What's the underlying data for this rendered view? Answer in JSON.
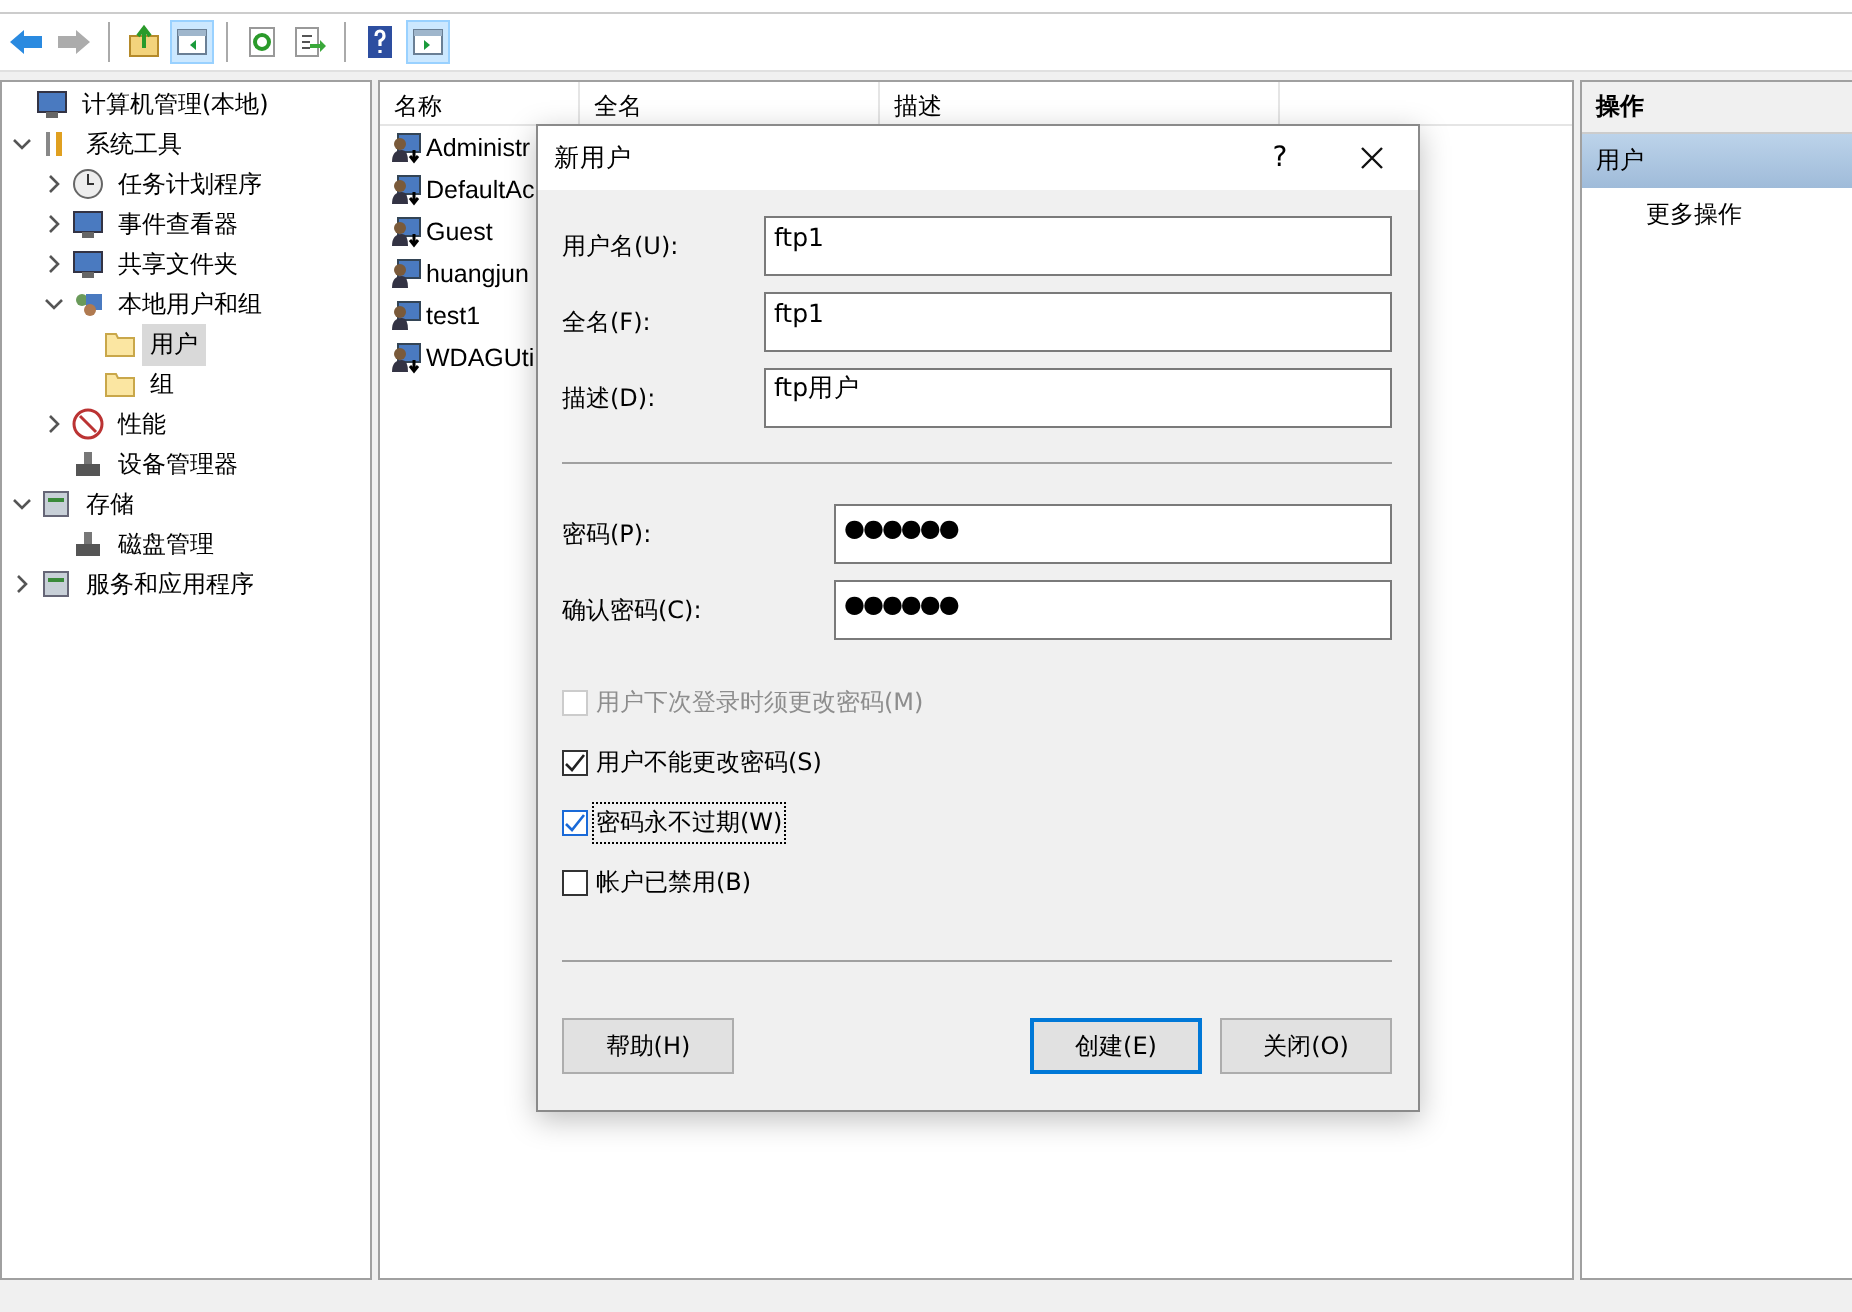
{
  "toolbar": [
    {
      "pressed": false,
      "disabled": false
    },
    {
      "pressed": false,
      "disabled": true
    },
    {
      "pressed": false,
      "disabled": false
    },
    {
      "pressed": true,
      "disabled": false
    },
    {
      "pressed": false,
      "disabled": false
    },
    {
      "pressed": false,
      "disabled": false
    },
    {
      "pressed": false,
      "disabled": false
    },
    {
      "pressed": true,
      "disabled": false
    }
  ],
  "tree": [
    {
      "label": "计算机管理(本地)",
      "selected": false,
      "children": [
        {
          "label": "系统工具",
          "expanded": true,
          "selected": false,
          "children": [
            {
              "label": "任务计划程序",
              "expanded": false,
              "selected": false
            },
            {
              "label": "事件查看器",
              "expanded": false,
              "selected": false
            },
            {
              "label": "共享文件夹",
              "expanded": false,
              "selected": false
            },
            {
              "label": "本地用户和组",
              "expanded": true,
              "selected": false,
              "children": [
                {
                  "label": "用户",
                  "selected": true
                },
                {
                  "label": "组",
                  "selected": false
                }
              ]
            },
            {
              "label": "性能",
              "expanded": false,
              "selected": false
            },
            {
              "label": "设备管理器",
              "selected": false
            }
          ]
        },
        {
          "label": "存储",
          "expanded": true,
          "selected": false,
          "children": [
            {
              "label": "磁盘管理",
              "selected": false
            }
          ]
        },
        {
          "label": "服务和应用程序",
          "expanded": false,
          "selected": false
        }
      ]
    }
  ],
  "list": {
    "columns": [
      "名称",
      "全名",
      "描述"
    ],
    "rows": [
      "Administr",
      "DefaultAc",
      "Guest",
      "huangjun",
      "test1",
      "WDAGUti"
    ]
  },
  "actions": {
    "title": "操作",
    "section": "用户",
    "items": [
      "更多操作"
    ]
  },
  "dialog": {
    "title": "新用户",
    "help": "?",
    "fields": [
      {
        "label": "用户名(U):",
        "value": "ftp1"
      },
      {
        "label": "全名(F):",
        "value": "ftp1"
      },
      {
        "label": "描述(D):",
        "value": "ftp用户"
      }
    ],
    "passwords": [
      {
        "label": "密码(P):",
        "value": "●●●●●●"
      },
      {
        "label": "确认密码(C):",
        "value": "●●●●●●"
      }
    ],
    "checkboxes": [
      {
        "label": "用户下次登录时须更改密码(M)",
        "checked": false,
        "disabled": true,
        "focused": false
      },
      {
        "label": "用户不能更改密码(S)",
        "checked": true,
        "disabled": false,
        "focused": false
      },
      {
        "label": "密码永不过期(W)",
        "checked": true,
        "disabled": false,
        "focused": true
      },
      {
        "label": "帐户已禁用(B)",
        "checked": false,
        "disabled": false,
        "focused": false
      }
    ],
    "buttons": [
      {
        "label": "帮助(H)",
        "default": false
      },
      {
        "label": "创建(E)",
        "default": true
      },
      {
        "label": "关闭(O)",
        "default": false
      }
    ]
  }
}
